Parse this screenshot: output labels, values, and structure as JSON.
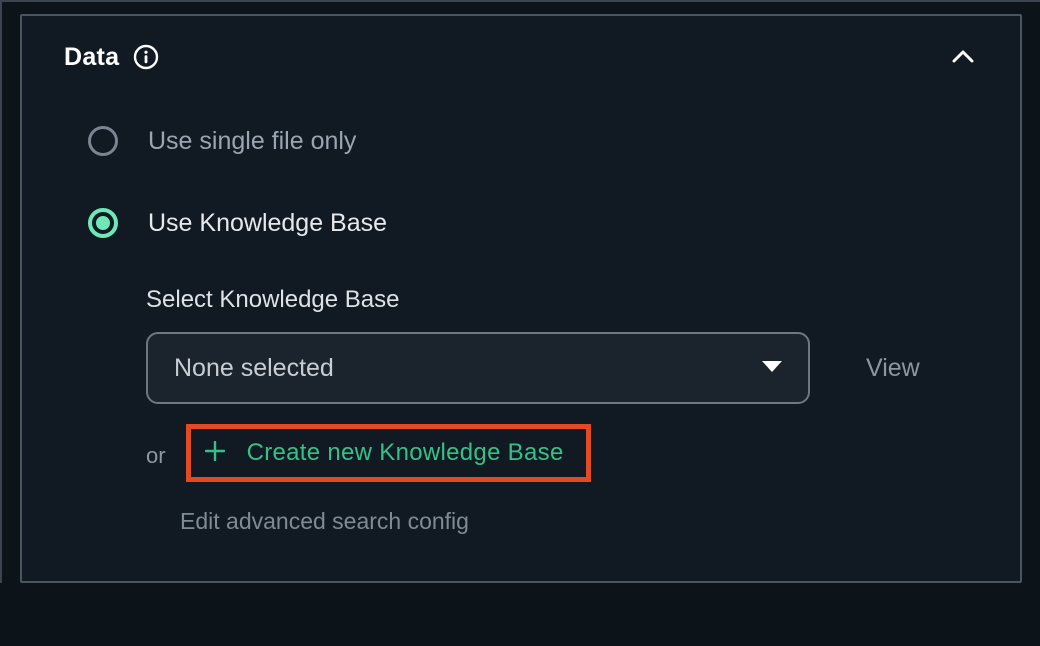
{
  "panel": {
    "title": "Data",
    "radios": {
      "singleFile": {
        "label": "Use single file only",
        "selected": false
      },
      "knowledgeBase": {
        "label": "Use Knowledge Base",
        "selected": true
      }
    },
    "kb": {
      "selectLabel": "Select Knowledge Base",
      "selectedValue": "None selected",
      "viewLabel": "View",
      "orLabel": "or",
      "createLabel": "Create new Knowledge Base",
      "advancedLabel": "Edit advanced search config"
    }
  },
  "colors": {
    "accentGreen": "#6fe8b7",
    "linkGreen": "#36c088",
    "highlightOrange": "#e24a24",
    "panelBg": "#111a22",
    "bodyBg": "#0d1419"
  }
}
